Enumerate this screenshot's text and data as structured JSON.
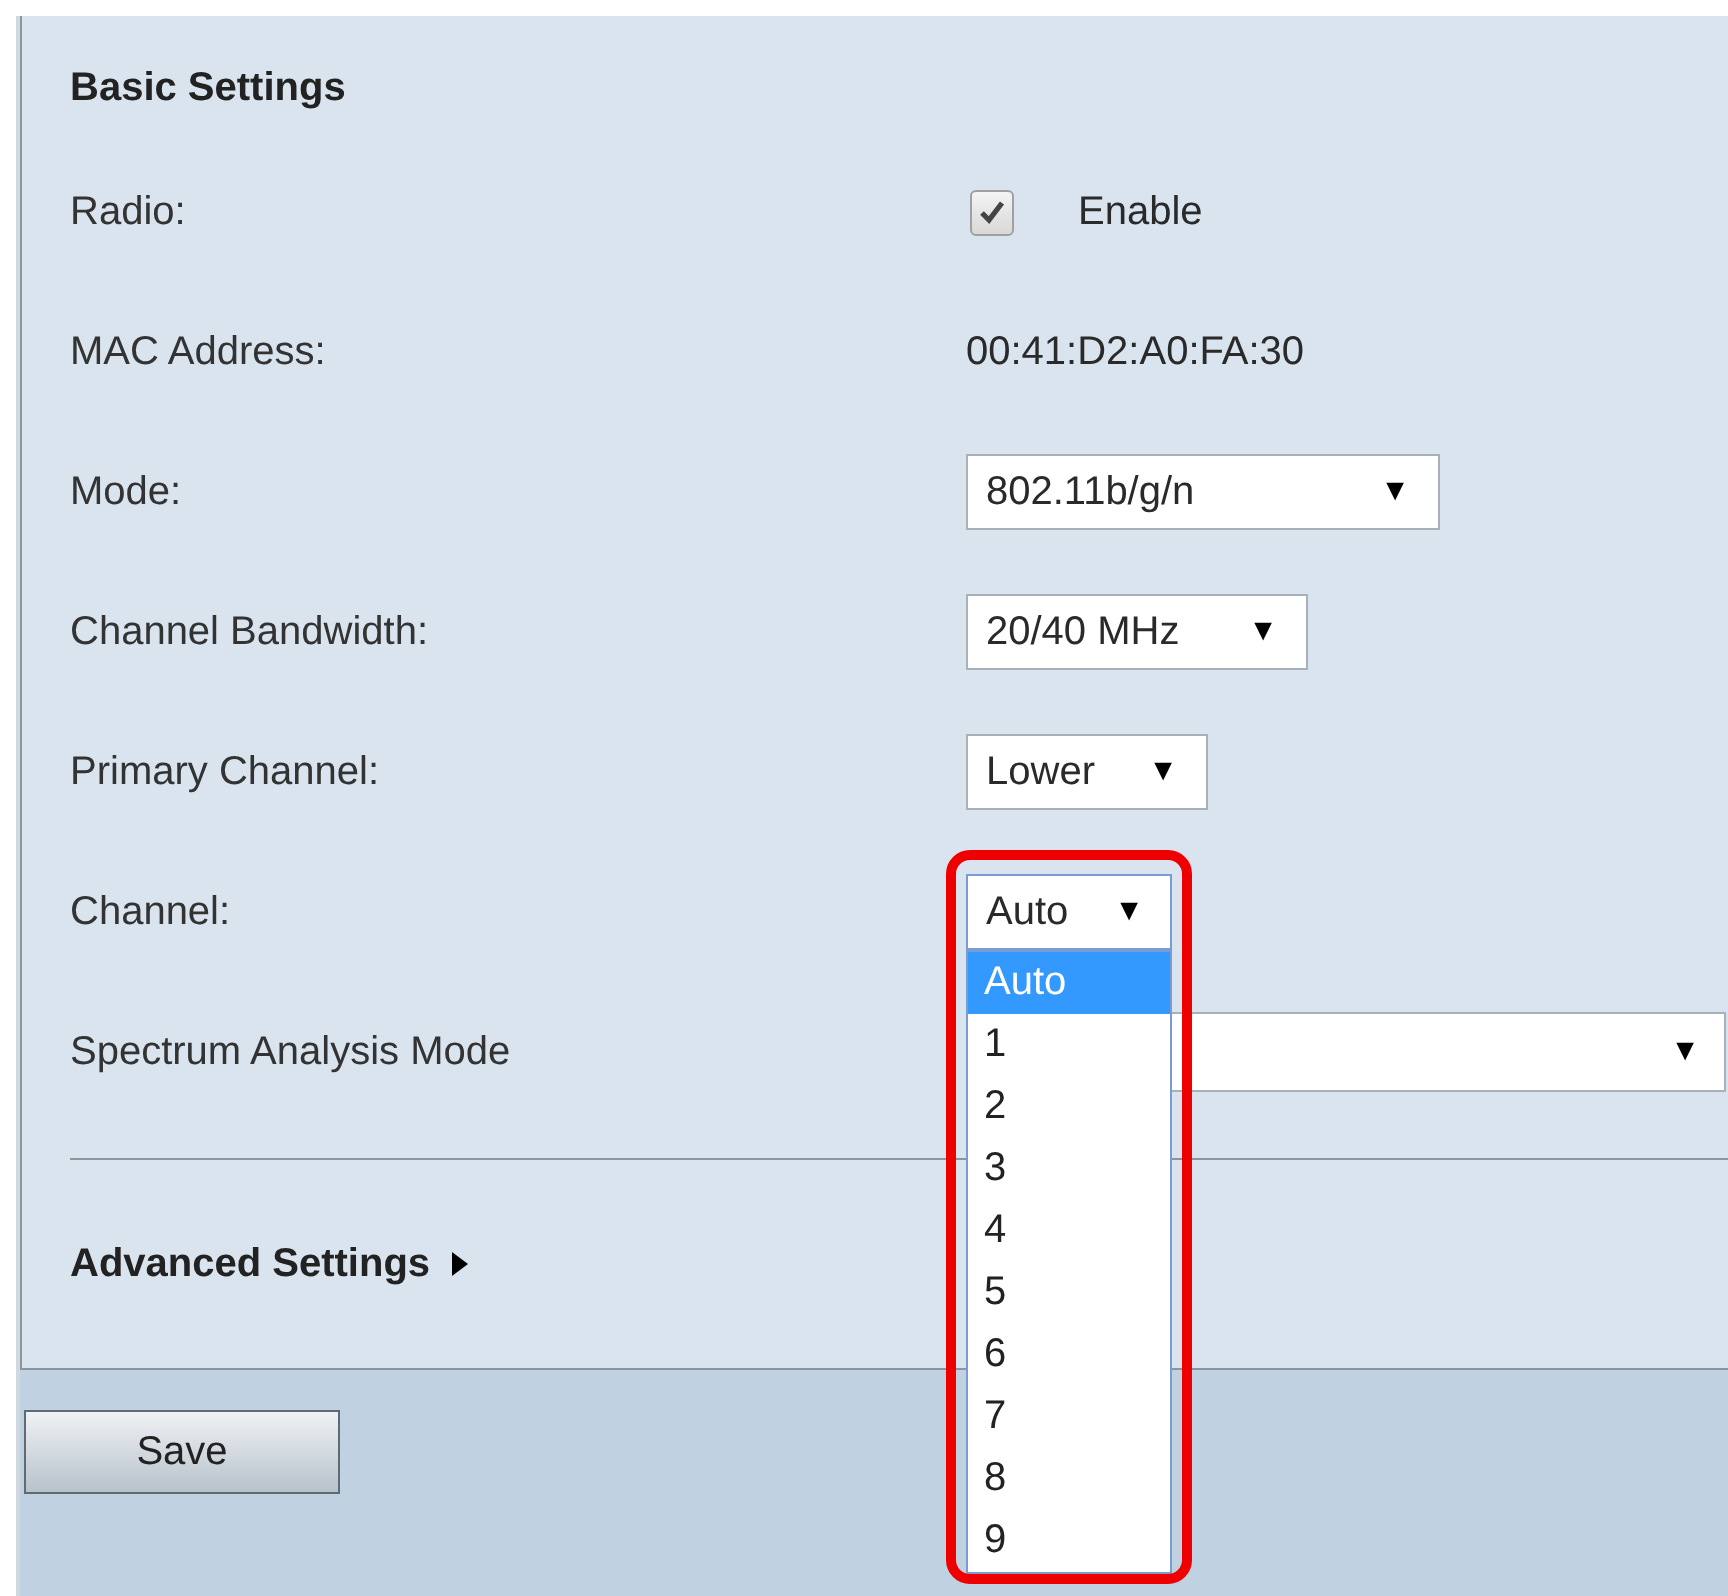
{
  "section": {
    "title": "Basic Settings"
  },
  "rows": [
    {
      "kind": "checkbox",
      "label": "Radio:",
      "checked": true,
      "value": "Enable"
    },
    {
      "kind": "text",
      "label": "MAC Address:",
      "value": "00:41:D2:A0:FA:30"
    },
    {
      "kind": "select",
      "label": "Mode:",
      "value": "802.11b/g/n",
      "arrow": "▼"
    },
    {
      "kind": "select",
      "label": "Channel Bandwidth:",
      "value": "20/40 MHz",
      "arrow": "▼"
    },
    {
      "kind": "select",
      "label": "Primary Channel:",
      "value": "Lower",
      "arrow": "▼"
    },
    {
      "kind": "dropdown",
      "label": "Channel:",
      "value": "Auto",
      "arrow": "▼",
      "expanded": true,
      "options": [
        {
          "label": "Auto",
          "selected": true
        },
        {
          "label": "1",
          "selected": false
        },
        {
          "label": "2",
          "selected": false
        },
        {
          "label": "3",
          "selected": false
        },
        {
          "label": "4",
          "selected": false
        },
        {
          "label": "5",
          "selected": false
        },
        {
          "label": "6",
          "selected": false
        },
        {
          "label": "7",
          "selected": false
        },
        {
          "label": "8",
          "selected": false
        },
        {
          "label": "9",
          "selected": false
        }
      ]
    },
    {
      "kind": "wide_select",
      "label": "Spectrum Analysis Mode",
      "arrow": "▼"
    }
  ],
  "advanced": {
    "title": "Advanced Settings",
    "expanded": false
  },
  "save_button": "Save"
}
